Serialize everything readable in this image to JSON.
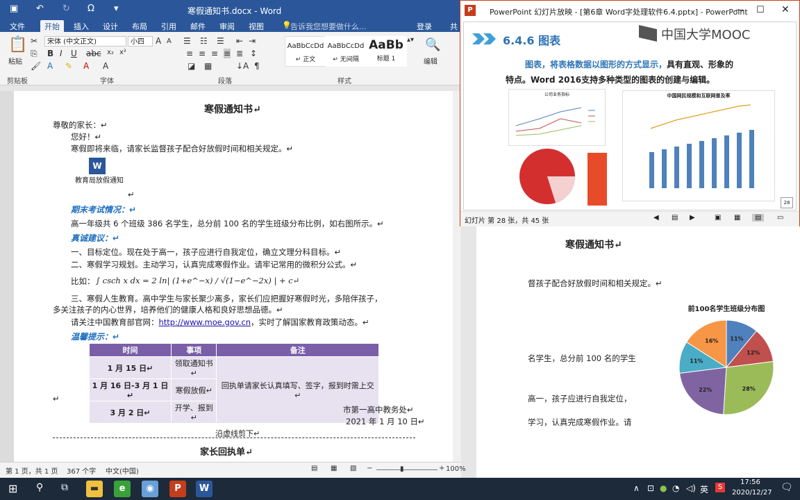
{
  "word": {
    "title": "寒假通知书.docx - Word",
    "tabs": [
      "文件",
      "开始",
      "插入",
      "设计",
      "布局",
      "引用",
      "邮件",
      "审阅",
      "视图"
    ],
    "active_tab": "开始",
    "tellme": "告诉我您想要做什么...",
    "login": "登录",
    "share": "共",
    "font_name": "宋体 (中文正文)",
    "font_size": "小四",
    "paste_label": "粘贴",
    "group_labels": {
      "clipboard": "剪贴板",
      "font": "字体",
      "paragraph": "段落",
      "styles": "样式",
      "edit": "编辑"
    },
    "styles": [
      {
        "sample": "AaBbCcDd",
        "name": "↵ 正文"
      },
      {
        "sample": "AaBbCcDd",
        "name": "↵ 无间隔"
      },
      {
        "sample": "AaBb",
        "name": "标题 1"
      }
    ],
    "status": {
      "page": "第 1 页，共 1 页",
      "words": "367 个字",
      "lang": "中文(中国)",
      "zoom": "100%"
    }
  },
  "doc": {
    "title": "寒假通知书↵",
    "greet": "尊敬的家长：↵",
    "hello": "您好！↵",
    "intro": "寒假即将来临，请家长监督孩子配合好放假时间和相关规定。↵",
    "attachment_label": "教育局放假通知",
    "h_exam": "期末考试情况：↵",
    "exam_text": "高一年级共 6 个班级 386 名学生，总分前 100 名的学生班级分布比例，如右图所示。↵",
    "h_advice": "真诚建议：↵",
    "advice1": "一、目标定位。现在处于高一，孩子应进行自我定位，确立文理分科目标。↵",
    "advice2": "二、寒假学习规划。主动学习，认真完成寒假作业。请牢记常用的微积分公式。↵",
    "formula_prefix": "比如：",
    "formula": "∫ csch x dx = 2 ln| (1+e^−x) / √(1−e^−2x) | + c↵",
    "advice3a": "三、寒假人生教育。高中学生与家长聚少离多，家长们应把握好寒假时光，多陪伴孩子，",
    "advice3b": "多关注孩子的内心世界，培养他们的健康人格和良好思想品德。↵",
    "site_pre": "请关注中国教育部官网：",
    "site_url": "http://www.moe.gov.cn",
    "site_post": "，实时了解国家教育政策动态。↵",
    "h_tips": "温馨提示：↵",
    "table_headers": [
      "时间",
      "事项",
      "备注"
    ],
    "table_rows": [
      [
        "1 月 15 日↵",
        "领取通知书↵"
      ],
      [
        "1 月 16 日-3 月 1 日↵",
        "寒假放假↵"
      ],
      [
        "3 月 2 日↵",
        "开学、报到↵"
      ]
    ],
    "table_note": "回执单请家长认真填写、签字，报到时需上交↵",
    "empty_mark": "↵",
    "sign_org": "市第一高中教务处↵",
    "sign_date": "2021 年 1 月 10 日↵",
    "cut_line": "沿虚线剪下↵",
    "receipt_title": "家长回执单↵"
  },
  "ppt": {
    "title": "PowerPoint 幻灯片放映 - [第6章 Word字处理软件6.4.pptx] - PowerPoint",
    "slide_heading": "6.4.6  图表",
    "mooc_logo": "中国大学MOOC",
    "slide_text_hl": "图表，将表格数据以图形的方式显示，",
    "slide_text_rest": "具有直观、形象的",
    "slide_text_2": "特点。Word 2016支持多种类型的图表的创建与编辑。",
    "thumb1_title": "公司业务指标",
    "thumb2_title": "中国网民规模和互联网普及率",
    "slide_number": "28",
    "status": "幻灯片 第 28 张，共 45 张",
    "colors": {
      "accent": "#c43e1c",
      "heading": "#1f6fbf",
      "text_hl": "#2e74b5"
    }
  },
  "right_doc": {
    "title": "寒假通知书↵",
    "frag1": "督孩子配合好放假时间和相关规定。↵",
    "frag2": "名学生，总分前 100 名的学生",
    "frag3": "高一，孩子应进行自我定位，",
    "frag4": "学习，认真完成寒假作业。请"
  },
  "chart_data": {
    "type": "pie",
    "title": "前100名学生班级分布图",
    "series": [
      {
        "values": [
          11,
          12,
          28,
          22,
          11,
          16
        ]
      }
    ],
    "labels": [
      "11%",
      "12%",
      "28%",
      "22%",
      "11%",
      "16%"
    ],
    "colors": [
      "#4f81bd",
      "#c0504d",
      "#9bbb59",
      "#8064a2",
      "#4bacc6",
      "#f79646"
    ]
  },
  "taskbar": {
    "time": "17:56",
    "date": "2020/12/27",
    "ime": "英"
  }
}
